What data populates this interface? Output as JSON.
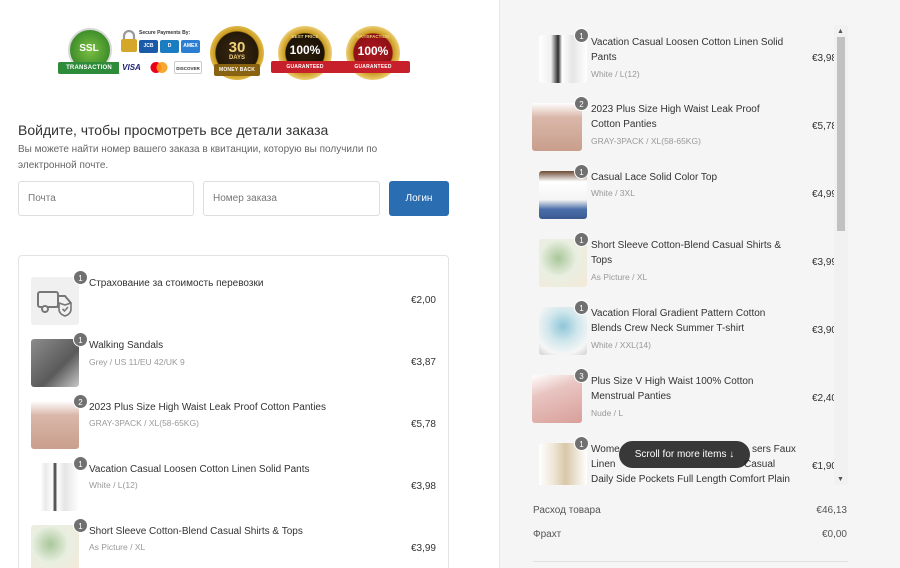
{
  "badges": {
    "ssl": {
      "line1": "SSL",
      "ribbon": "TRANSACTION"
    },
    "secure": {
      "title": "Secure Payments By:",
      "cards": [
        "JCB",
        "D",
        "AMEX",
        "VISA",
        "MC",
        "DISCOVER"
      ]
    },
    "days": {
      "number": "30",
      "line2": "DAYS",
      "ribbon": "MONEY BACK"
    },
    "best": {
      "top": "BEST PRICE",
      "number": "100%",
      "ribbon": "GUARANTEED"
    },
    "satisfaction": {
      "top": "SATISFACTION",
      "number": "100%",
      "ribbon": "GUARANTEED"
    }
  },
  "login": {
    "title": "Войдите, чтобы просмотреть все детали заказа",
    "subtitle": "Вы можете найти номер вашего заказа в квитанции, которую вы получили по электронной почте.",
    "email_placeholder": "Почта",
    "order_placeholder": "Номер заказа",
    "button": "Логин"
  },
  "left_items": [
    {
      "qty": "1",
      "name": "Страхование за стоимость перевозки",
      "variant": "",
      "price": "€2,00"
    },
    {
      "qty": "1",
      "name": "Walking Sandals",
      "variant": "Grey / US 11/EU 42/UK 9",
      "price": "€3,87"
    },
    {
      "qty": "2",
      "name": "2023 Plus Size High Waist Leak Proof Cotton Panties",
      "variant": "GRAY-3PACK / XL(58-65KG)",
      "price": "€5,78"
    },
    {
      "qty": "1",
      "name": "Vacation Casual Loosen Cotton Linen Solid Pants",
      "variant": "White / L(12)",
      "price": "€3,98"
    },
    {
      "qty": "1",
      "name": "Short Sleeve Cotton-Blend Casual Shirts & Tops",
      "variant": "As Picture / XL",
      "price": "€3,99"
    }
  ],
  "right_items": [
    {
      "qty": "1",
      "name1": "Vacation Casual Loosen Cotton Linen Solid",
      "name2": "Pants",
      "name3": "",
      "variant": "White / L(12)",
      "price": "€3,98"
    },
    {
      "qty": "2",
      "name1": "2023 Plus Size High Waist Leak Proof",
      "name2": "Cotton Panties",
      "name3": "",
      "variant": "GRAY-3PACK / XL(58-65KG)",
      "price": "€5,78"
    },
    {
      "qty": "1",
      "name1": "Casual Lace Solid Color Top",
      "name2": "",
      "name3": "",
      "variant": "White / 3XL",
      "price": "€4,99"
    },
    {
      "qty": "1",
      "name1": "Short Sleeve Cotton-Blend Casual Shirts &",
      "name2": "Tops",
      "name3": "",
      "variant": "As Picture / XL",
      "price": "€3,99"
    },
    {
      "qty": "1",
      "name1": "Vacation Floral Gradient Pattern Cotton",
      "name2": "Blends Crew Neck Summer T-shirt",
      "name3": "",
      "variant": "White / XXL(14)",
      "price": "€3,90"
    },
    {
      "qty": "3",
      "name1": "Plus Size V High Waist 100% Cotton",
      "name2": "Menstrual Panties",
      "name3": "",
      "variant": "Nude / L",
      "price": "€2,40"
    },
    {
      "qty": "1",
      "name1": "Wome",
      "name1b": "sers Faux",
      "name2": "Linen",
      "name2b": "Casual",
      "name3": "Daily Side Pockets Full Length Comfort Plain",
      "variant": "",
      "price": "€1,90"
    }
  ],
  "scroll_hint": "Scroll for more items ↓",
  "summary": {
    "subtotal_label": "Расход товара",
    "subtotal_value": "€46,13",
    "shipping_label": "Фрахт",
    "shipping_value": "€0,00"
  },
  "colors": {
    "accent": "#2a6db1",
    "badge_gold": "#c99a1e",
    "ribbon_green": "#2e8b3a",
    "ribbon_red": "#c8202a"
  }
}
